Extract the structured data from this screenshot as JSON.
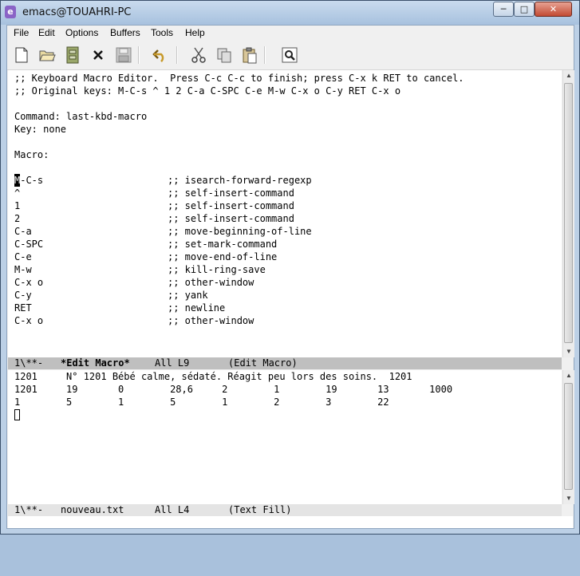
{
  "window": {
    "title": "emacs@TOUAHRI-PC",
    "app_icon_glyph": "e",
    "controls": {
      "minimize": "─",
      "maximize": "□",
      "close": "✕"
    }
  },
  "menubar": {
    "items": [
      "File",
      "Edit",
      "Options",
      "Buffers",
      "Tools",
      "Help"
    ]
  },
  "toolbar": {
    "buttons": [
      "new-file-icon",
      "open-folder-icon",
      "dired-icon",
      "close-buffer-icon",
      "save-icon",
      "undo-icon",
      "cut-icon",
      "copy-icon",
      "paste-icon",
      "search-icon"
    ]
  },
  "top_buffer": {
    "lines": [
      ";; Keyboard Macro Editor.  Press C-c C-c to finish; press C-x k RET to cancel.",
      ";; Original keys: M-C-s ^ 1 2 C-a C-SPC C-e M-w C-x o C-y RET C-x o",
      "",
      "Command: last-kbd-macro",
      "Key: none",
      "",
      "Macro:",
      ""
    ],
    "macro_keys": [
      {
        "key": "M-C-s",
        "comment": ";; isearch-forward-regexp"
      },
      {
        "key": "^",
        "comment": ";; self-insert-command"
      },
      {
        "key": "1",
        "comment": ";; self-insert-command"
      },
      {
        "key": "2",
        "comment": ";; self-insert-command"
      },
      {
        "key": "C-a",
        "comment": ";; move-beginning-of-line"
      },
      {
        "key": "C-SPC",
        "comment": ";; set-mark-command"
      },
      {
        "key": "C-e",
        "comment": ";; move-end-of-line"
      },
      {
        "key": "M-w",
        "comment": ";; kill-ring-save"
      },
      {
        "key": "C-x o",
        "comment": ";; other-window"
      },
      {
        "key": "C-y",
        "comment": ";; yank"
      },
      {
        "key": "RET",
        "comment": ";; newline"
      },
      {
        "key": "C-x o",
        "comment": ";; other-window"
      }
    ],
    "cursor_char": "M",
    "cursor_rest": "-C-s"
  },
  "modeline_top": {
    "status": "1\\**-",
    "buffer": "*Edit Macro*",
    "position": "All L9",
    "mode": "(Edit Macro)"
  },
  "bottom_buffer": {
    "lines": [
      "1201     N° 1201 Bébé calme, sédaté. Réagit peu lors des soins.  1201",
      "1201     19       0        28,6     2        1        19       13       1000",
      "1        5        1        5        1        2        3        22"
    ]
  },
  "modeline_bottom": {
    "status": "1\\**-",
    "buffer": "nouveau.txt",
    "position": "All L4",
    "mode": "(Text Fill)"
  }
}
